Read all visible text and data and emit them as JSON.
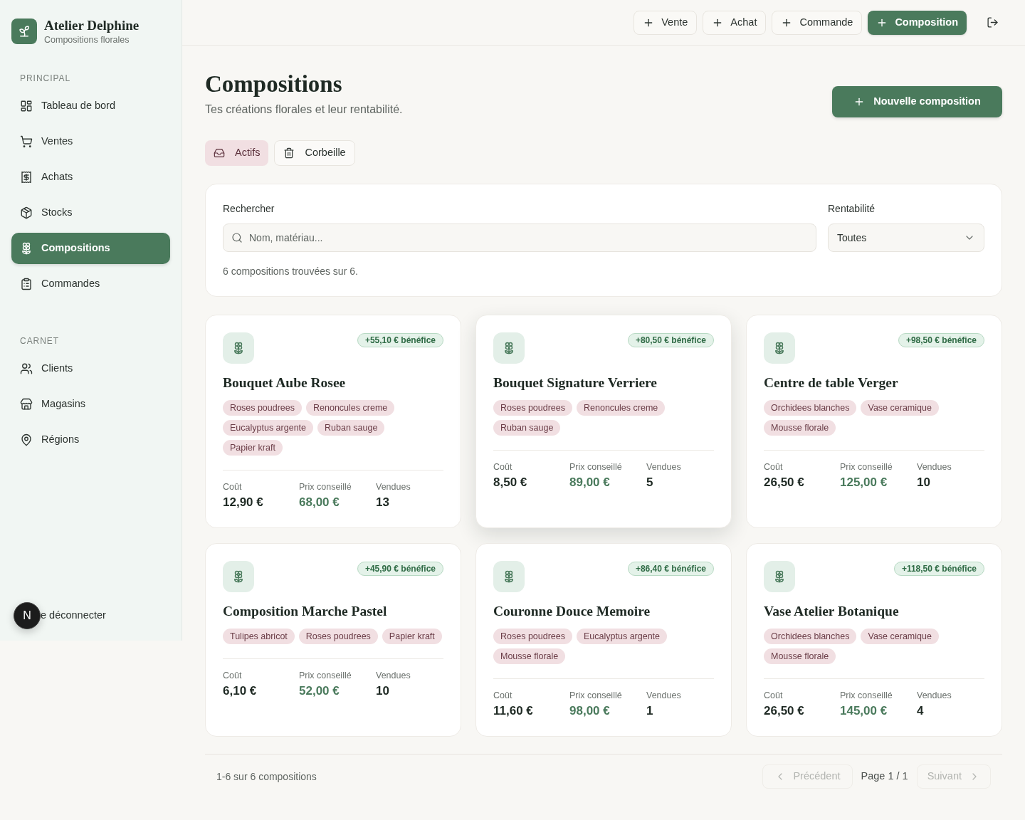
{
  "sidebar": {
    "brand": {
      "name": "Atelier Delphine",
      "tagline": "Compositions florales"
    },
    "sections": [
      {
        "title": "PRINCIPAL",
        "items": [
          {
            "label": "Tableau de bord",
            "selected": false
          },
          {
            "label": "Ventes",
            "selected": false
          },
          {
            "label": "Achats",
            "selected": false
          },
          {
            "label": "Stocks",
            "selected": false
          },
          {
            "label": "Compositions",
            "selected": true
          },
          {
            "label": "Commandes",
            "selected": false
          }
        ]
      },
      {
        "title": "CARNET",
        "items": [
          {
            "label": "Clients",
            "selected": false
          },
          {
            "label": "Magasins",
            "selected": false
          },
          {
            "label": "Régions",
            "selected": false
          }
        ]
      }
    ],
    "dev_badge": "N",
    "logout": "e déconnecter"
  },
  "topbar": {
    "actions": [
      {
        "label": "Vente",
        "primary": false
      },
      {
        "label": "Achat",
        "primary": false
      },
      {
        "label": "Commande",
        "primary": false
      },
      {
        "label": "Composition",
        "primary": true
      }
    ]
  },
  "header": {
    "title": "Compositions",
    "subtitle": "Tes créations florales et leur rentabilité.",
    "primary_action": "Nouvelle composition"
  },
  "tabs": [
    {
      "label": "Actifs",
      "selected": true
    },
    {
      "label": "Corbeille",
      "selected": false
    }
  ],
  "filters": {
    "search": {
      "label": "Rechercher",
      "placeholder": "Nom, matériau..."
    },
    "profitability": {
      "label": "Rentabilité",
      "value": "Toutes"
    },
    "result_count": "6 compositions trouvées sur 6."
  },
  "cards": [
    {
      "name": "Bouquet Aube Rosee",
      "profit": "+55,10 € bénéfice",
      "elevated": false,
      "materials": [
        "Roses poudrees",
        "Renoncules creme",
        "Eucalyptus argente",
        "Ruban sauge",
        "Papier kraft"
      ],
      "stats": [
        {
          "kind": "cost",
          "label": "Coût",
          "value": "12,90 €"
        },
        {
          "kind": "price",
          "label": "Prix conseillé",
          "value": "68,00 €"
        },
        {
          "kind": "count",
          "label": "Vendues",
          "value": "13"
        }
      ]
    },
    {
      "name": "Bouquet Signature Verriere",
      "profit": "+80,50 € bénéfice",
      "elevated": true,
      "materials": [
        "Roses poudrees",
        "Renoncules creme",
        "Ruban sauge"
      ],
      "stats": [
        {
          "kind": "cost",
          "label": "Coût",
          "value": "8,50 €"
        },
        {
          "kind": "price",
          "label": "Prix conseillé",
          "value": "89,00 €"
        },
        {
          "kind": "count",
          "label": "Vendues",
          "value": "5"
        }
      ]
    },
    {
      "name": "Centre de table Verger",
      "profit": "+98,50 € bénéfice",
      "elevated": false,
      "materials": [
        "Orchidees blanches",
        "Vase ceramique",
        "Mousse florale"
      ],
      "stats": [
        {
          "kind": "cost",
          "label": "Coût",
          "value": "26,50 €"
        },
        {
          "kind": "price",
          "label": "Prix conseillé",
          "value": "125,00 €"
        },
        {
          "kind": "count",
          "label": "Vendues",
          "value": "10"
        }
      ]
    },
    {
      "name": "Composition Marche Pastel",
      "profit": "+45,90 € bénéfice",
      "elevated": false,
      "materials": [
        "Tulipes abricot",
        "Roses poudrees",
        "Papier kraft"
      ],
      "stats": [
        {
          "kind": "cost",
          "label": "Coût",
          "value": "6,10 €"
        },
        {
          "kind": "price",
          "label": "Prix conseillé",
          "value": "52,00 €"
        },
        {
          "kind": "count",
          "label": "Vendues",
          "value": "10"
        }
      ]
    },
    {
      "name": "Couronne Douce Memoire",
      "profit": "+86,40 € bénéfice",
      "elevated": false,
      "materials": [
        "Roses poudrees",
        "Eucalyptus argente",
        "Mousse florale"
      ],
      "stats": [
        {
          "kind": "cost",
          "label": "Coût",
          "value": "11,60 €"
        },
        {
          "kind": "price",
          "label": "Prix conseillé",
          "value": "98,00 €"
        },
        {
          "kind": "count",
          "label": "Vendues",
          "value": "1"
        }
      ]
    },
    {
      "name": "Vase Atelier Botanique",
      "profit": "+118,50 € bénéfice",
      "elevated": false,
      "materials": [
        "Orchidees blanches",
        "Vase ceramique",
        "Mousse florale"
      ],
      "stats": [
        {
          "kind": "cost",
          "label": "Coût",
          "value": "26,50 €"
        },
        {
          "kind": "price",
          "label": "Prix conseillé",
          "value": "145,00 €"
        },
        {
          "kind": "count",
          "label": "Vendues",
          "value": "4"
        }
      ]
    }
  ],
  "pagination": {
    "summary": "1-6 sur 6 compositions",
    "previous": {
      "label": "Précédent",
      "disabled": true
    },
    "page": "Page 1 / 1",
    "next": {
      "label": "Suivant",
      "disabled": true
    }
  }
}
